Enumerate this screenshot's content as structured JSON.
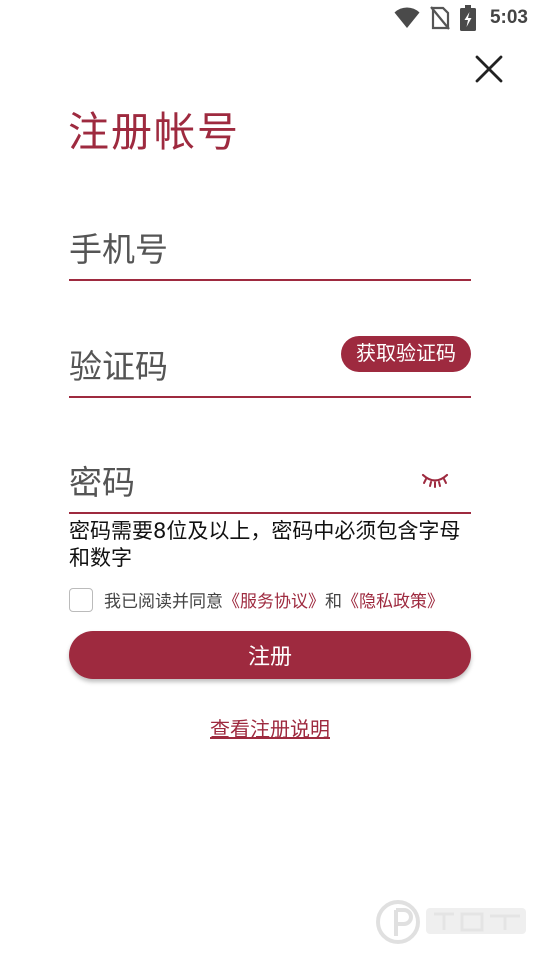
{
  "status_bar": {
    "time": "5:03",
    "icons": [
      "wifi-icon",
      "no-sim-icon",
      "battery-charging-icon"
    ]
  },
  "header": {
    "close_icon": "close-icon",
    "title": "注册帐号"
  },
  "form": {
    "phone_placeholder": "手机号",
    "code_placeholder": "验证码",
    "get_code_label": "获取验证码",
    "password_placeholder": "密码",
    "password_toggle_icon": "eye-closed-icon",
    "password_hint": "密码需要8位及以上，密码中必须包含字母和数字"
  },
  "agreement": {
    "prefix": "我已阅读并同意",
    "terms_link": "《服务协议》",
    "conjunction": "和",
    "privacy_link": "《隐私政策》"
  },
  "actions": {
    "register_label": "注册",
    "instructions_link": "查看注册说明"
  },
  "colors": {
    "accent": "#9e2a3f"
  }
}
